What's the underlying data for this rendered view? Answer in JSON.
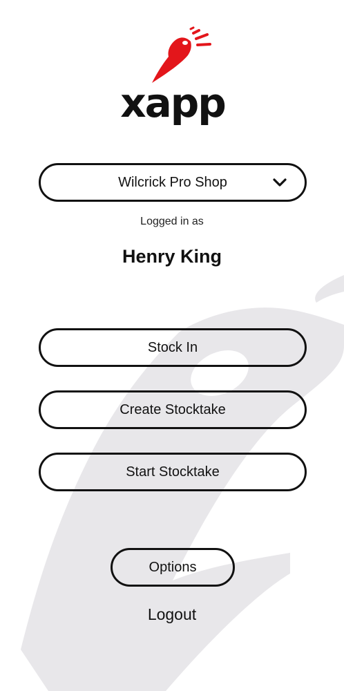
{
  "brand": {
    "logo_text": "xapp",
    "accent_color": "#e3161b",
    "icon": "xapp-logo-icon"
  },
  "shop_selector": {
    "selected": "Wilcrick Pro Shop",
    "icon": "chevron-down-icon"
  },
  "session": {
    "logged_in_label": "Logged in as",
    "user_name": "Henry King"
  },
  "actions": {
    "stock_in": "Stock In",
    "create_stocktake": "Create Stocktake",
    "start_stocktake": "Start Stocktake",
    "options": "Options",
    "logout": "Logout"
  },
  "colors": {
    "background": "#ffffff",
    "watermark": "#e8e7ea",
    "text": "#111111"
  }
}
